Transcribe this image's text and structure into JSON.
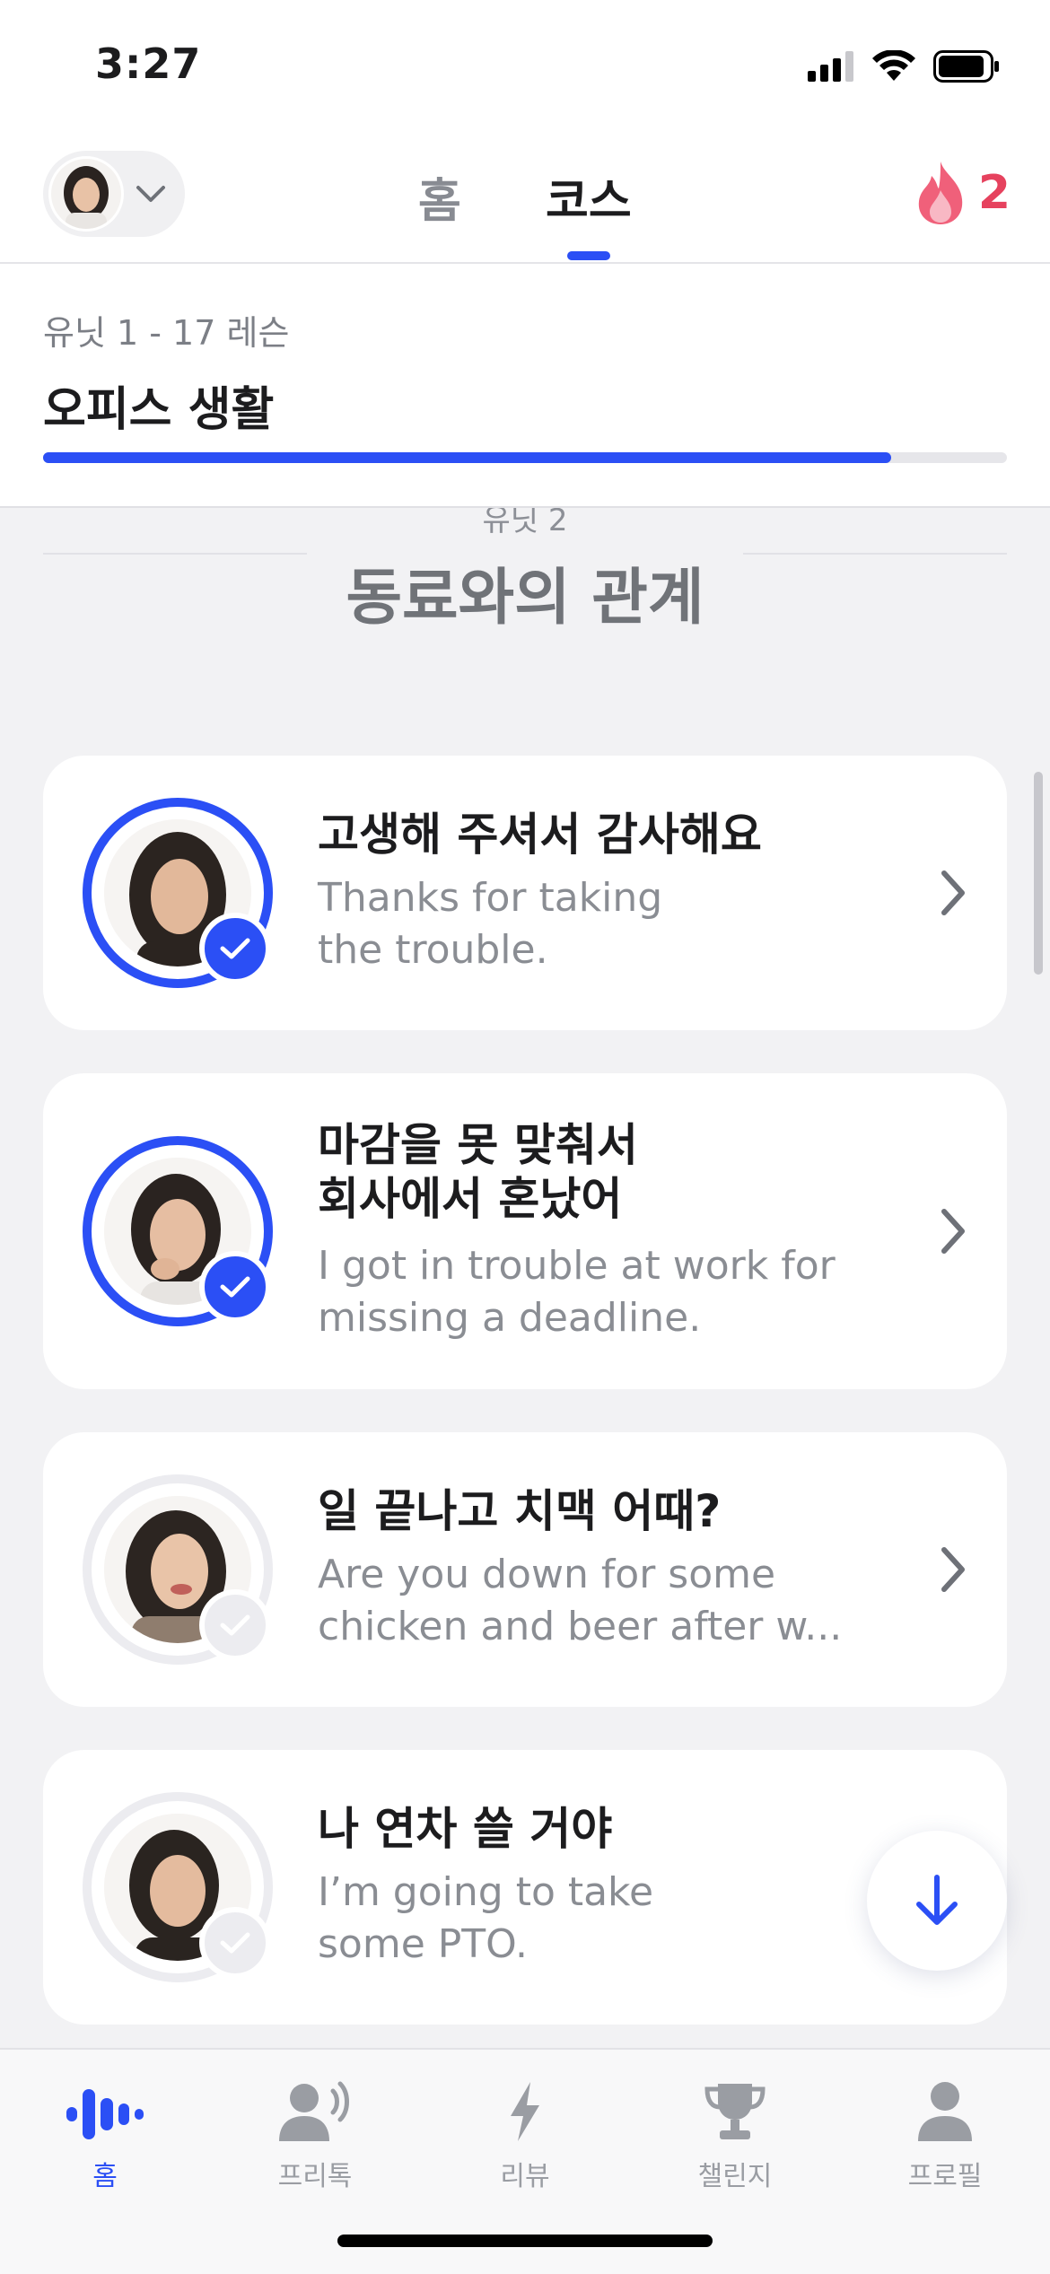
{
  "status_bar": {
    "time": "3:27"
  },
  "header": {
    "tabs": [
      {
        "label": "홈",
        "active": false
      },
      {
        "label": "코스",
        "active": true
      }
    ],
    "streak_count": "2"
  },
  "unit": {
    "subtitle": "유닛 1 - 17 레슨",
    "title": "오피스 생활",
    "progress": 0.88
  },
  "section": {
    "unit_label": "유닛 2",
    "title": "동료와의 관계"
  },
  "lessons": [
    {
      "korean": "고생해 주셔서 감사해요",
      "english_line1": "Thanks for taking",
      "english_line2": "the trouble.",
      "completed": true
    },
    {
      "korean_line1": "마감을 못 맞춰서",
      "korean_line2": "회사에서 혼났어",
      "english_line1": "I got in trouble at work for",
      "english_line2": "missing a deadline.",
      "completed": true
    },
    {
      "korean": "일 끝나고 치맥 어때?",
      "english_line1": "Are you down for some",
      "english_line2": "chicken and beer after w...",
      "completed": false
    },
    {
      "korean": "나 연차 쓸 거야",
      "english_line1": "I’m going to take",
      "english_line2": "some PTO.",
      "completed": false
    }
  ],
  "tab_bar": [
    {
      "label": "홈",
      "icon": "voice-wave-icon",
      "active": true
    },
    {
      "label": "프리톡",
      "icon": "speaking-person-icon",
      "active": false
    },
    {
      "label": "리뷰",
      "icon": "lightning-icon",
      "active": false
    },
    {
      "label": "챌린지",
      "icon": "trophy-icon",
      "active": false
    },
    {
      "label": "프로필",
      "icon": "person-icon",
      "active": false
    }
  ],
  "colors": {
    "accent": "#2b4ff5",
    "streak": "#e6425e"
  }
}
